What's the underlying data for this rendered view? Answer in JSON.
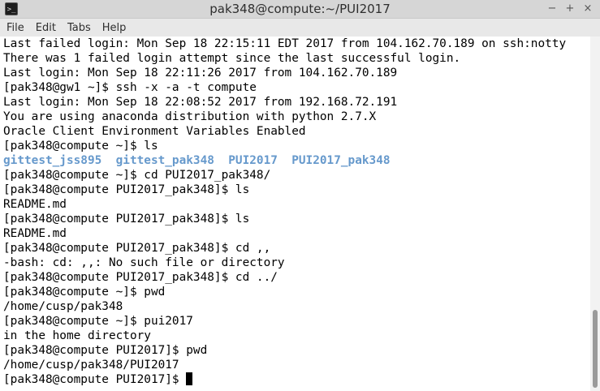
{
  "window": {
    "title": "pak348@compute:~/PUI2017",
    "controls": {
      "minimize": "−",
      "maximize": "+",
      "close": "×"
    }
  },
  "menu": [
    "File",
    "Edit",
    "Tabs",
    "Help"
  ],
  "terminal": {
    "lines": [
      "Last failed login: Mon Sep 18 22:15:11 EDT 2017 from 104.162.70.189 on ssh:notty",
      "There was 1 failed login attempt since the last successful login.",
      "Last login: Mon Sep 18 22:11:26 2017 from 104.162.70.189",
      "[pak348@gw1 ~]$ ssh -x -a -t compute",
      "Last login: Mon Sep 18 22:08:52 2017 from 192.168.72.191",
      "You are using anaconda distribution with python 2.7.X",
      "Oracle Client Environment Variables Enabled",
      "[pak348@compute ~]$ ls",
      "",
      "[pak348@compute ~]$ cd PUI2017_pak348/",
      "[pak348@compute PUI2017_pak348]$ ls",
      "README.md",
      "[pak348@compute PUI2017_pak348]$ ls",
      "README.md",
      "[pak348@compute PUI2017_pak348]$ cd ,,",
      "-bash: cd: ,,: No such file or directory",
      "[pak348@compute PUI2017_pak348]$ cd ../",
      "[pak348@compute ~]$ pwd",
      "/home/cusp/pak348",
      "[pak348@compute ~]$ pui2017",
      "in the home directory",
      "[pak348@compute PUI2017]$ pwd",
      "/home/cusp/pak348/PUI2017"
    ],
    "ls_listing": [
      "gittest_jss895",
      "gittest_pak348",
      "PUI2017",
      "PUI2017_pak348"
    ],
    "prompt": "[pak348@compute PUI2017]$ ",
    "dir_color": "#6699cc"
  }
}
